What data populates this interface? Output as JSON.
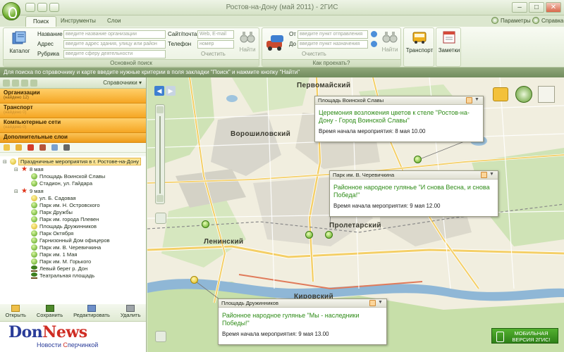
{
  "window": {
    "title": "Ростов-на-Дону (май 2011) - 2ГИС"
  },
  "tabs": [
    {
      "label": "Поиск",
      "active": true
    },
    {
      "label": "Инструменты",
      "active": false
    },
    {
      "label": "Слои",
      "active": false
    }
  ],
  "tab_right": {
    "params": "Параметры",
    "help": "Справка"
  },
  "search": {
    "catalog_label": "Каталог",
    "name_label": "Название",
    "name_placeholder": "введите название организации",
    "address_label": "Адрес",
    "address_placeholder": "введите адрес здания, улицу или район",
    "rubric_label": "Рубрика",
    "rubric_placeholder": "введите сферу деятельности",
    "site_label": "Сайт/почта",
    "site_placeholder": "Web, E-mail",
    "phone_label": "Телефон",
    "phone_placeholder": "номер",
    "clear_label": "Очистить",
    "find_label": "Найти",
    "caption": "Основной поиск"
  },
  "route": {
    "from_label": "От",
    "from_placeholder": "введите пункт отправления",
    "to_label": "До",
    "to_placeholder": "введите пункт назначения",
    "clear_label": "Очистить",
    "find_label": "Найти",
    "caption": "Как проехать?"
  },
  "ribbon_buttons": {
    "transport": "Транспорт",
    "notes": "Заметки"
  },
  "hint": "Для поиска по справочнику и карте введите нужные критерии в поля закладки \"Поиск\" и нажмите кнопку \"Найти\"",
  "left_panel": {
    "handbooks_label": "Справочники",
    "categories": [
      {
        "title": "Организации",
        "sub": "(найдено 12)"
      },
      {
        "title": "Транспорт",
        "sub": "(найдено 0)"
      },
      {
        "title": "Компьютерные сети",
        "sub": "(найдено 0)"
      },
      {
        "title": "Дополнительные слои",
        "sub": ""
      }
    ],
    "tree": {
      "root": "Праздничные мероприятия в г. Ростове-на-Дону",
      "day1": "8 мая",
      "day1_items": [
        "Площадь Воинской Славы",
        "Стадион, ул. Гайдара"
      ],
      "day2": "9 мая",
      "day2_items": [
        "ул. Б. Садовая",
        "Парк им. Н. Островского",
        "Парк Дружбы",
        "Парк им. города Плевен",
        "Площадь Дружинников",
        "Парк Октября",
        "Гарнизонный Дом офицеров",
        "Парк им. В. Черевичкина",
        "Парк им. 1 Мая",
        "Парк им. М. Горького",
        "Левый берег р. Дон",
        "Театральная площадь"
      ]
    },
    "actions": {
      "open": "Открыть",
      "save": "Сохранить",
      "edit": "Редактировать",
      "delete": "Удалить"
    },
    "banner": {
      "logo_a": "Don",
      "logo_b": "News",
      "slogan_a": "Новости",
      "slogan_b": "перчинкой"
    }
  },
  "map": {
    "districts": [
      "Первомайский",
      "Ворошиловский",
      "Пролетарский",
      "Ленинский",
      "Кировский"
    ],
    "popups": [
      {
        "head": "Площадь Воинской Славы",
        "title": "Церемония возложения цветов к стеле \"Ростов-на-Дону - Город Воинской Славы\"",
        "time": "Время начала мероприятия: 8 мая 10.00"
      },
      {
        "head": "Парк им. В. Черевичкина",
        "title": "Районное народное гулянье \"И снова Весна, и снова Победа!\"",
        "time": "Время начала мероприятия: 9 мая 12.00"
      },
      {
        "head": "Площадь Дружинников",
        "title": "Районное народное гулянье \"Мы - наследники Победы!\"",
        "time": "Время начала мероприятия: 9 мая 13.00"
      }
    ],
    "mobile_badge": {
      "line1": "МОБИЛЬНАЯ",
      "line2": "ВЕРСИЯ 2ГИС!"
    }
  },
  "colors": {
    "accent": "#f5a623",
    "popup_title": "#2e8b17",
    "ribbon": "#e3ecd7"
  }
}
